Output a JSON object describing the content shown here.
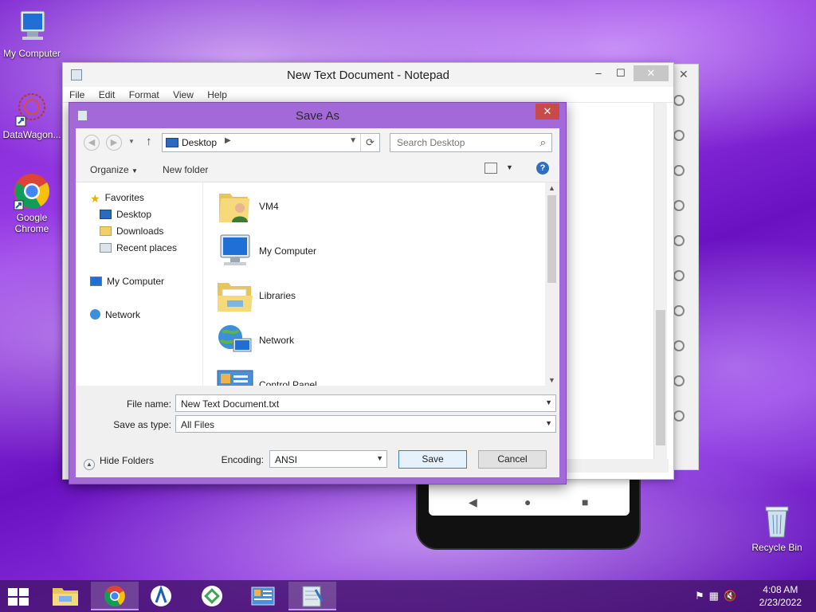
{
  "desktop": {
    "icons": [
      {
        "label": "My Computer"
      },
      {
        "label": "DataWagon..."
      },
      {
        "label": "Google Chrome"
      },
      {
        "label": "Recycle Bin"
      }
    ]
  },
  "notepad": {
    "title": "New Text Document - Notepad",
    "menu": [
      "File",
      "Edit",
      "Format",
      "View",
      "Help"
    ],
    "controls": {
      "minimize": "–",
      "maximize": "☐",
      "close": "✕"
    }
  },
  "emulator": {
    "close": "✕"
  },
  "dialog": {
    "title": "Save As",
    "close": "✕",
    "address": {
      "location": "Desktop"
    },
    "search": {
      "placeholder": "Search Desktop"
    },
    "toolbar": {
      "organize": "Organize",
      "new_folder": "New folder",
      "help": "?"
    },
    "nav": {
      "favorites": "Favorites",
      "favorite_items": [
        "Desktop",
        "Downloads",
        "Recent places"
      ],
      "my_computer": "My Computer",
      "network": "Network"
    },
    "files": [
      "VM4",
      "My Computer",
      "Libraries",
      "Network",
      "Control Panel"
    ],
    "file_name_label": "File name:",
    "file_name_value": "New Text Document.txt",
    "save_type_label": "Save as type:",
    "save_type_value": "All Files",
    "encoding_label": "Encoding:",
    "encoding_value": "ANSI",
    "save_button": "Save",
    "cancel_button": "Cancel",
    "hide_folders": "Hide Folders"
  },
  "taskbar": {
    "time": "4:08 AM",
    "date": "2/23/2022"
  },
  "colors": {
    "dialog_frame": "#a469d8",
    "close_red": "#c94a4a",
    "taskbar": "#46146e"
  }
}
